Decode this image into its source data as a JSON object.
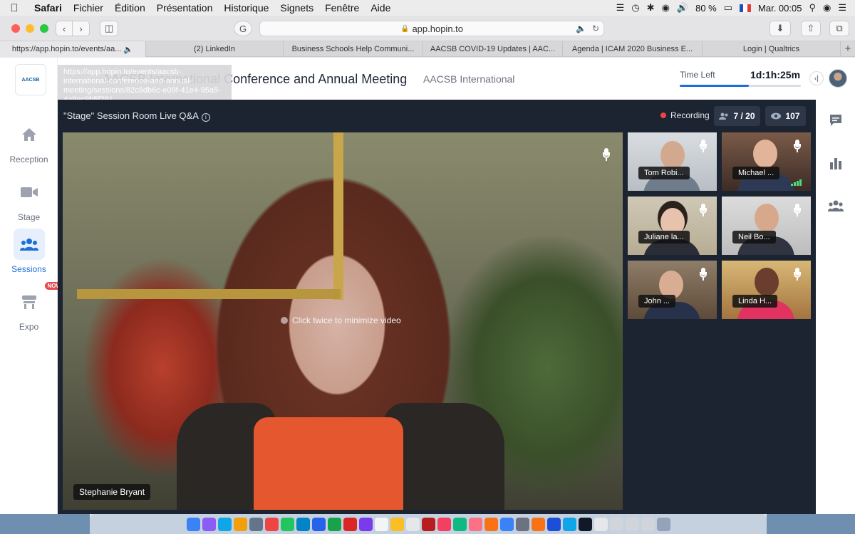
{
  "menubar": {
    "app": "Safari",
    "items": [
      "Fichier",
      "Édition",
      "Présentation",
      "Historique",
      "Signets",
      "Fenêtre",
      "Aide"
    ],
    "battery": "80 %",
    "clock": "Mar. 00:05"
  },
  "browser": {
    "url": "app.hopin.to",
    "tabs": [
      "https://app.hopin.to/events/aa...",
      "(2) LinkedIn",
      "Business Schools Help Communi...",
      "AACSB COVID-19 Updates | AAC...",
      "Agenda | ICAM 2020 Business E...",
      "Login | Qualtrics"
    ],
    "hover_url": "https://app.hopin.to/events/aacsb-international-conference-and-annual-meeting/sessions/82c8db6c-e09f-41e4-95a5-4a9ec9b5f291"
  },
  "header": {
    "logo_text": "AACSB",
    "event_title": "AACSB International Conference and Annual Meeting",
    "organizer": "AACSB International",
    "time_left_label": "Time Left",
    "time_left_value": "1d:1h:25m",
    "time_progress": 0.57
  },
  "nav": [
    {
      "label": "Reception",
      "icon": "home-icon"
    },
    {
      "label": "Stage",
      "icon": "camera-icon"
    },
    {
      "label": "Sessions",
      "icon": "people-icon",
      "active": true
    },
    {
      "label": "Expo",
      "icon": "booth-icon",
      "badge": "NOW"
    }
  ],
  "session": {
    "title": "\"Stage\" Session Room Live Q&A",
    "recording_label": "Recording",
    "participants": "7 / 20",
    "viewers": "107",
    "minimize_hint": "Click twice to minimize video",
    "main_speaker": "Stephanie Bryant",
    "tiles": [
      {
        "name": "Tom Robi..."
      },
      {
        "name": "Michael ..."
      },
      {
        "name": "Juliane la..."
      },
      {
        "name": "Neil Bo..."
      },
      {
        "name": "John ..."
      },
      {
        "name": "Linda H..."
      }
    ]
  },
  "colors": {
    "accent": "#1b6fd6",
    "stage_bg": "#1c2431",
    "recording": "#ef4444"
  }
}
